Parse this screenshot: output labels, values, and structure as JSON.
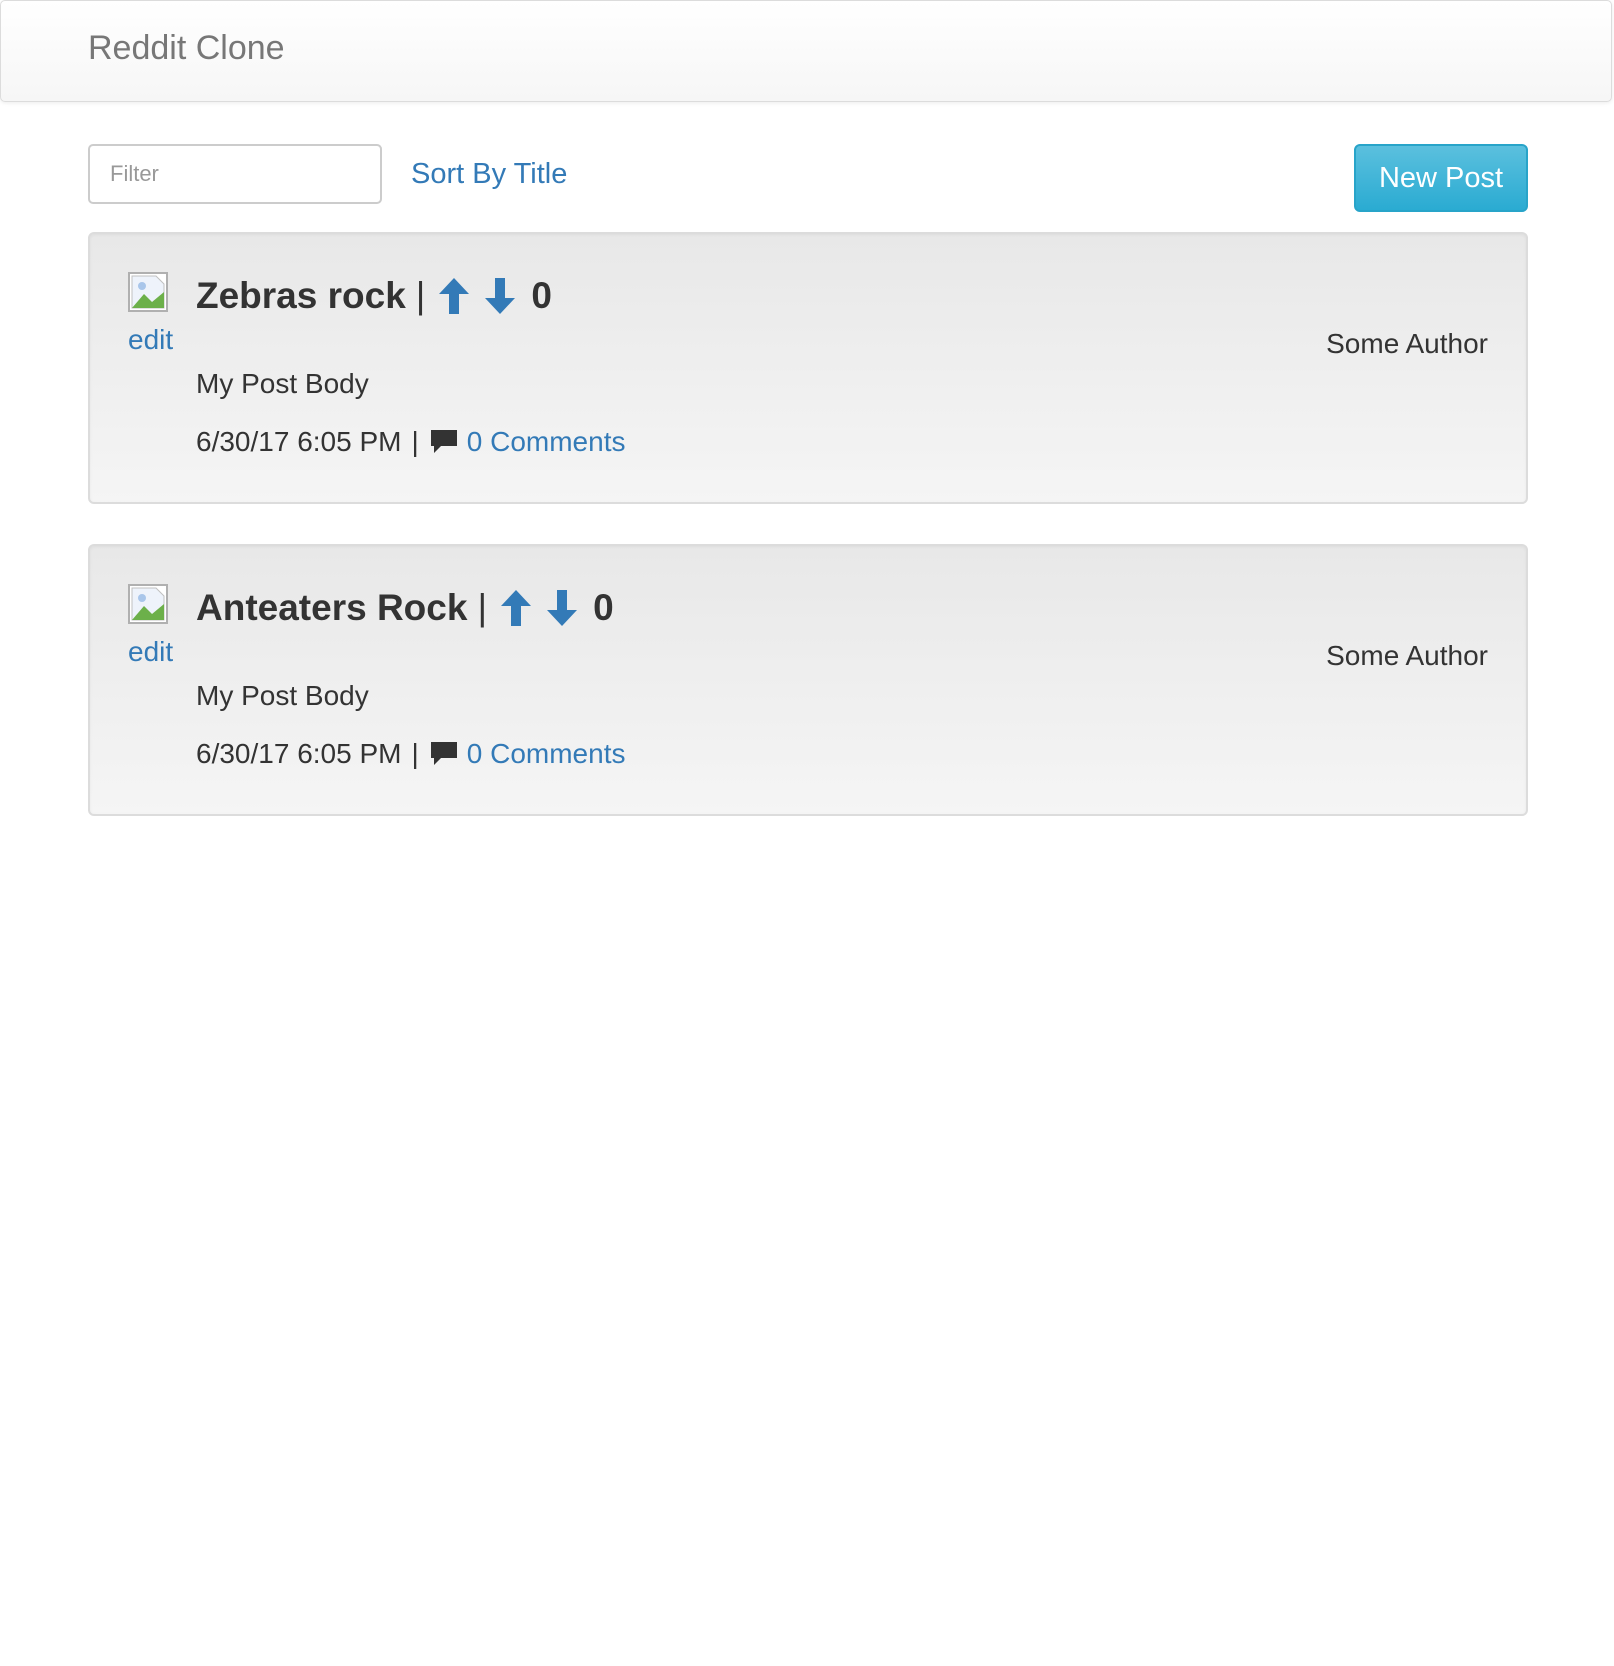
{
  "navbar": {
    "brand": "Reddit Clone"
  },
  "toolbar": {
    "filter_placeholder": "Filter",
    "filter_value": "",
    "sort_label": "Sort By Title",
    "new_post_label": "New Post"
  },
  "posts": [
    {
      "title": "Zebras rock",
      "title_separator": "|",
      "score": "0",
      "edit_label": "edit",
      "author": "Some Author",
      "body": "My Post Body",
      "timestamp": "6/30/17 6:05 PM",
      "meta_separator": "|",
      "comments_label": "0 Comments",
      "thumbnail_icon": "broken-image-icon",
      "upvote_icon": "arrow-up-icon",
      "downvote_icon": "arrow-down-icon",
      "comment_icon": "speech-bubble-icon"
    },
    {
      "title": "Anteaters Rock",
      "title_separator": "|",
      "score": "0",
      "edit_label": "edit",
      "author": "Some Author",
      "body": "My Post Body",
      "timestamp": "6/30/17 6:05 PM",
      "meta_separator": "|",
      "comments_label": "0 Comments",
      "thumbnail_icon": "broken-image-icon",
      "upvote_icon": "arrow-up-icon",
      "downvote_icon": "arrow-down-icon",
      "comment_icon": "speech-bubble-icon"
    }
  ],
  "colors": {
    "link": "#337ab7",
    "button_bg": "#31b0d5",
    "text": "#333333",
    "brand": "#777777"
  }
}
